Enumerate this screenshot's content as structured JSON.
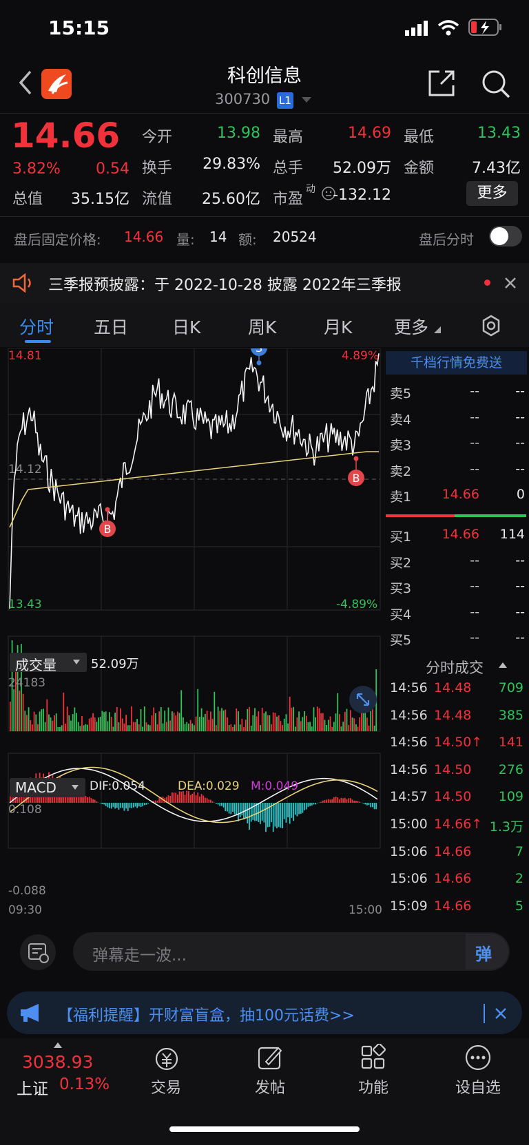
{
  "status_bar": {
    "time": "15:15"
  },
  "header": {
    "title": "科创信息",
    "code": "300730",
    "level_badge": "L1"
  },
  "quote": {
    "price": "14.66",
    "change_pct": "3.82%",
    "change": "0.54",
    "open_label": "今开",
    "open": "13.98",
    "high_label": "最高",
    "high": "14.69",
    "low_label": "最低",
    "low": "13.43",
    "turnover_label": "换手",
    "turnover": "29.83%",
    "volume_label": "总手",
    "volume": "52.09万",
    "amount_label": "金额",
    "amount": "7.43亿",
    "mktcap_label": "总值",
    "mktcap": "35.15亿",
    "float_label": "流值",
    "float_cap": "25.60亿",
    "pe_label": "市盈",
    "pe_sup": "动",
    "pe": "-132.12",
    "more_button": "更多"
  },
  "after_hours": {
    "price_label": "盘后固定价格:",
    "price": "14.66",
    "vol_label": "量:",
    "vol": "14",
    "amt_label": "额:",
    "amt": "20524",
    "toggle_label": "盘后分时",
    "toggle_on": false
  },
  "notice": {
    "text": "三季报预披露：于 2022-10-28 披露 2022年三季报"
  },
  "tabs": [
    {
      "label": "分时",
      "active": true
    },
    {
      "label": "五日"
    },
    {
      "label": "日K"
    },
    {
      "label": "周K"
    },
    {
      "label": "月K"
    },
    {
      "label": "更多"
    }
  ],
  "chart": {
    "price_top": "14.81",
    "price_bottom": "13.43",
    "price_mid": "14.12",
    "pct_top": "4.89%",
    "pct_bottom": "-4.89%",
    "volume_selector": "成交量",
    "volume_total": "52.09万",
    "volume_max": "24183",
    "macd_selector": "MACD",
    "dif": "DIF:0.054",
    "dea": "DEA:0.029",
    "m": "M:0.049",
    "macd_top": "0.108",
    "macd_bottom": "-0.088",
    "time_start": "09:30",
    "time_end": "15:00",
    "marker_s": "S",
    "marker_b": "B"
  },
  "order_book": {
    "banner": "千档行情免费送",
    "asks": [
      {
        "label": "卖5",
        "price": "--",
        "vol": "--"
      },
      {
        "label": "卖4",
        "price": "--",
        "vol": "--"
      },
      {
        "label": "卖3",
        "price": "--",
        "vol": "--"
      },
      {
        "label": "卖2",
        "price": "--",
        "vol": "--"
      },
      {
        "label": "卖1",
        "price": "14.66",
        "vol": "0"
      }
    ],
    "bids": [
      {
        "label": "买1",
        "price": "14.66",
        "vol": "114"
      },
      {
        "label": "买2",
        "price": "--",
        "vol": "--"
      },
      {
        "label": "买3",
        "price": "--",
        "vol": "--"
      },
      {
        "label": "买4",
        "price": "--",
        "vol": "--"
      },
      {
        "label": "买5",
        "price": "--",
        "vol": "--"
      }
    ]
  },
  "trades": {
    "header": "分时成交",
    "rows": [
      {
        "time": "14:56",
        "price": "14.48",
        "vol": "709",
        "pc": "red",
        "vc": "green"
      },
      {
        "time": "14:56",
        "price": "14.48",
        "vol": "385",
        "pc": "red",
        "vc": "green"
      },
      {
        "time": "14:56",
        "price": "14.50↑",
        "vol": "141",
        "pc": "red",
        "vc": "red"
      },
      {
        "time": "14:56",
        "price": "14.50",
        "vol": "276",
        "pc": "red",
        "vc": "green"
      },
      {
        "time": "14:57",
        "price": "14.50",
        "vol": "109",
        "pc": "red",
        "vc": "green"
      },
      {
        "time": "15:00",
        "price": "14.66↑",
        "vol": "1.3万",
        "pc": "red",
        "vc": "green"
      },
      {
        "time": "15:06",
        "price": "14.66",
        "vol": "7",
        "pc": "red",
        "vc": "green"
      },
      {
        "time": "15:06",
        "price": "14.66",
        "vol": "2",
        "pc": "red",
        "vc": "green"
      },
      {
        "time": "15:09",
        "price": "14.66",
        "vol": "5",
        "pc": "red",
        "vc": "green"
      }
    ]
  },
  "danmaku": {
    "placeholder": "弹幕走一波...",
    "send_label": "弹"
  },
  "promo": {
    "text": "【福利提醒】开财富盲盒，抽100元话费>>"
  },
  "bottom_bar": {
    "index_value": "3038.93",
    "index_name": "上证",
    "index_pct": "0.13%",
    "items": [
      "交易",
      "发帖",
      "功能",
      "设自选"
    ]
  },
  "colors": {
    "up": "#f2323a",
    "down": "#2fc35a",
    "accent": "#3b8cf0",
    "avg_line": "#e8d27a",
    "macd_down": "#2bc5c9"
  }
}
